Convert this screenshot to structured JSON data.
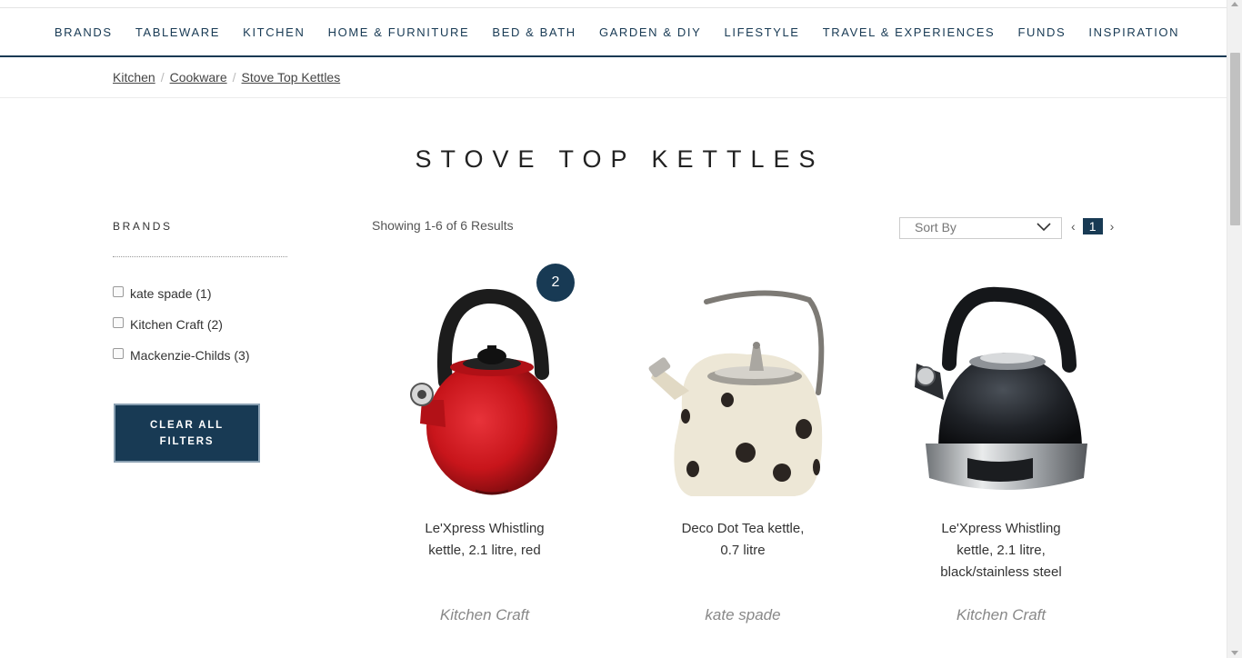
{
  "nav": {
    "items": [
      "BRANDS",
      "TABLEWARE",
      "KITCHEN",
      "HOME & FURNITURE",
      "BED & BATH",
      "GARDEN & DIY",
      "LIFESTYLE",
      "TRAVEL & EXPERIENCES",
      "FUNDS",
      "INSPIRATION"
    ]
  },
  "breadcrumb": {
    "items": [
      "Kitchen",
      "Cookware",
      "Stove Top Kettles"
    ],
    "separator": "/"
  },
  "page": {
    "title": "STOVE TOP KETTLES"
  },
  "filters": {
    "heading": "BRANDS",
    "options": [
      "kate spade (1)",
      "Kitchen Craft (2)",
      "Mackenzie-Childs (3)"
    ],
    "clear_label": "CLEAR ALL FILTERS"
  },
  "results": {
    "showing": "Showing 1-6 of 6 Results",
    "sort_label": "Sort By",
    "current_page": "1",
    "prev_glyph": "‹",
    "next_glyph": "›"
  },
  "products": [
    {
      "name": "Le'Xpress Whistling kettle, 2.1 litre, red",
      "brand": "Kitchen Craft",
      "badge": "2",
      "image": "red-whistling-kettle"
    },
    {
      "name": "Deco Dot Tea kettle, 0.7 litre",
      "brand": "kate spade",
      "image": "cream-polka-dot-kettle"
    },
    {
      "name": "Le'Xpress Whistling kettle, 2.1 litre, black/stainless steel",
      "brand": "Kitchen Craft",
      "image": "black-steel-whistling-kettle"
    }
  ],
  "colors": {
    "navy": "#183a54",
    "kettle_red": "#c8151b",
    "kettle_cream": "#ede7d6",
    "kettle_black": "#1e2126"
  },
  "icons": [
    "chevron-down-icon",
    "chevron-left-icon",
    "chevron-right-icon"
  ]
}
